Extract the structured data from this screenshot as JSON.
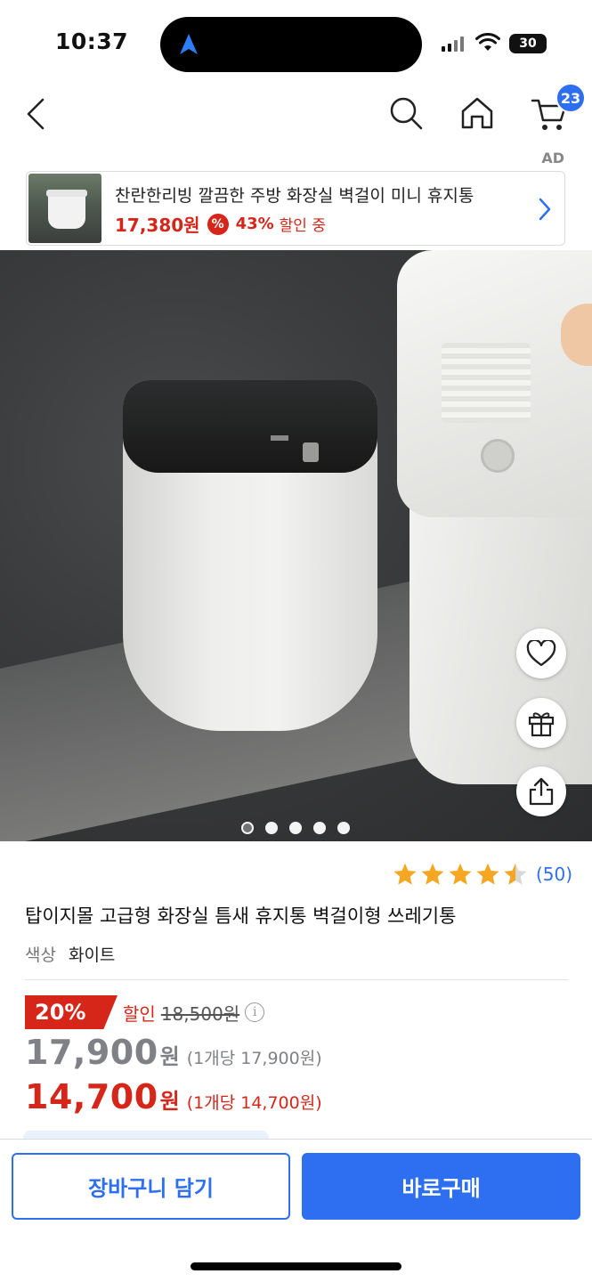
{
  "status_bar": {
    "time": "10:37",
    "battery": "30"
  },
  "nav": {
    "cart_count": "23"
  },
  "ad": {
    "label": "AD",
    "title": "찬란한리빙 깔끔한 주방 화장실 벽걸이 미니 휴지통",
    "price": "17,380원",
    "discount_icon": "%",
    "discount": "43%",
    "discount_word": "할인 중"
  },
  "product": {
    "rating": 4.5,
    "review_count": "(50)",
    "title": "탑이지몰 고급형 화장실 틈새 휴지통 벽걸이형 쓰레기통",
    "option_label": "색상",
    "option_value": "화이트",
    "discount_badge": "20%",
    "discount_word": "할인",
    "original_price": "18,500원",
    "info_icon": "i",
    "price": "17,900",
    "price_won": "원",
    "price_unit": "(1개당 17,900원)",
    "sale_price": "14,700",
    "sale_price_won": "원",
    "sale_price_unit": "(1개당 14,700원)"
  },
  "gallery": {
    "total_images": 5,
    "active_index": 0
  },
  "actions": {
    "add_to_cart": "장바구니 담기",
    "buy_now": "바로구매"
  },
  "colors": {
    "accent": "#2e6ff2",
    "sale": "#d6261a",
    "star": "#f5a623"
  },
  "icons": [
    "back-icon",
    "search-icon",
    "home-icon",
    "cart-icon",
    "heart-icon",
    "gift-icon",
    "share-icon",
    "star-icon",
    "chevron-right-icon"
  ]
}
